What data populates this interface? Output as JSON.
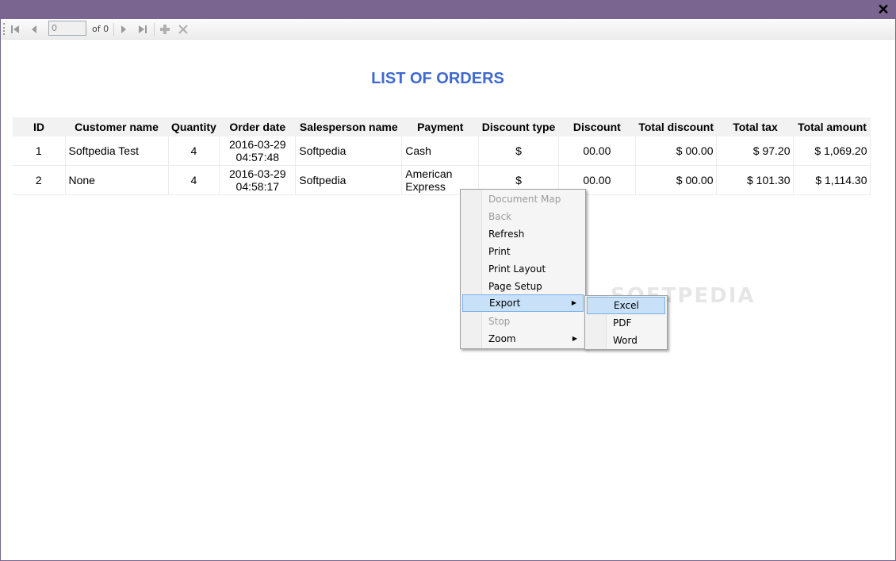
{
  "window": {
    "close_glyph": "✕"
  },
  "toolbar": {
    "first_icon": "first-page-icon",
    "prev_icon": "previous-page-icon",
    "page_value": "0",
    "of_text": "of 0",
    "next_icon": "next-page-icon",
    "last_icon": "last-page-icon",
    "zoom_in_icon": "plus-icon",
    "stop_icon": "x-icon"
  },
  "report": {
    "title": "LIST OF ORDERS",
    "columns": [
      "ID",
      "Customer name",
      "Quantity",
      "Order date",
      "Salesperson name",
      "Payment",
      "Discount type",
      "Discount",
      "Total discount",
      "Total tax",
      "Total amount"
    ],
    "rows": [
      {
        "id": "1",
        "customer": "Softpedia Test",
        "quantity": "4",
        "date": "2016-03-29",
        "time": "04:57:48",
        "salesperson": "Softpedia",
        "payment1": "Cash",
        "payment2": "",
        "discount_type": "$",
        "discount": "00.00",
        "total_discount": "$ 00.00",
        "total_tax": "$ 97.20",
        "total_amount": "$ 1,069.20"
      },
      {
        "id": "2",
        "customer": "None",
        "quantity": "4",
        "date": "2016-03-29",
        "time": "04:58:17",
        "salesperson": "Softpedia",
        "payment1": "American",
        "payment2": "Express",
        "discount_type": "$",
        "discount": "00.00",
        "total_discount": "$ 00.00",
        "total_tax": "$ 101.30",
        "total_amount": "$ 1,114.30"
      }
    ]
  },
  "context_menu": {
    "items": [
      "Document Map",
      "Back",
      "Refresh",
      "Print",
      "Print Layout",
      "Page Setup",
      "Export",
      "Stop",
      "Zoom"
    ]
  },
  "export_submenu": {
    "items": [
      "Excel",
      "PDF",
      "Word"
    ]
  },
  "watermark": "SOFTPEDIA",
  "colors": {
    "titlebar": "#7a6490",
    "title": "#3f69d1",
    "highlight": "#c8e0f8"
  }
}
